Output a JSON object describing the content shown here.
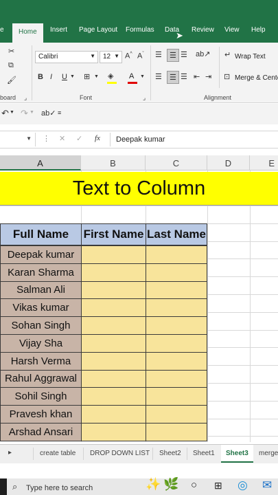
{
  "ribbon_tabs": [
    {
      "label": "e"
    },
    {
      "label": "Home"
    },
    {
      "label": "Insert"
    },
    {
      "label": "Page Layout"
    },
    {
      "label": "Formulas"
    },
    {
      "label": "Data"
    },
    {
      "label": "Review"
    },
    {
      "label": "View"
    },
    {
      "label": "Help"
    }
  ],
  "active_tab": "Home",
  "font_group": {
    "font_name": "Calibri",
    "font_size": "12",
    "label": "Font"
  },
  "clipboard_label": "board",
  "alignment_group": {
    "wrap_text": "Wrap Text",
    "merge_center": "Merge & Cente",
    "label": "Alignment"
  },
  "formula_bar": {
    "fx": "fx",
    "value": "Deepak kumar"
  },
  "columns": [
    "A",
    "B",
    "C",
    "D",
    "E"
  ],
  "selected_column": "A",
  "banner_title": "Text to Column",
  "table": {
    "headers": [
      "Full Name",
      "First Name",
      "Last Name"
    ],
    "rows": [
      "Deepak kumar",
      "Karan Sharma",
      "Salman Ali",
      "Vikas kumar",
      "Sohan Singh",
      "Vijay Sha",
      "Harsh Verma",
      "Rahul Aggrawal",
      "Sohil Singh",
      "Pravesh khan",
      "Arshad Ansari"
    ]
  },
  "sheet_tabs": [
    "create table",
    "DROP DOWN LIST",
    "Sheet2",
    "Sheet1",
    "Sheet3",
    "merge"
  ],
  "active_sheet": "Sheet3",
  "taskbar": {
    "search_placeholder": "Type here to search"
  },
  "colors": {
    "excel_green": "#217346",
    "banner_yellow": "#ffff00",
    "header_blue": "#b9c9e4",
    "name_fill": "#c8b4a7",
    "empty_fill": "#f8e49b"
  }
}
